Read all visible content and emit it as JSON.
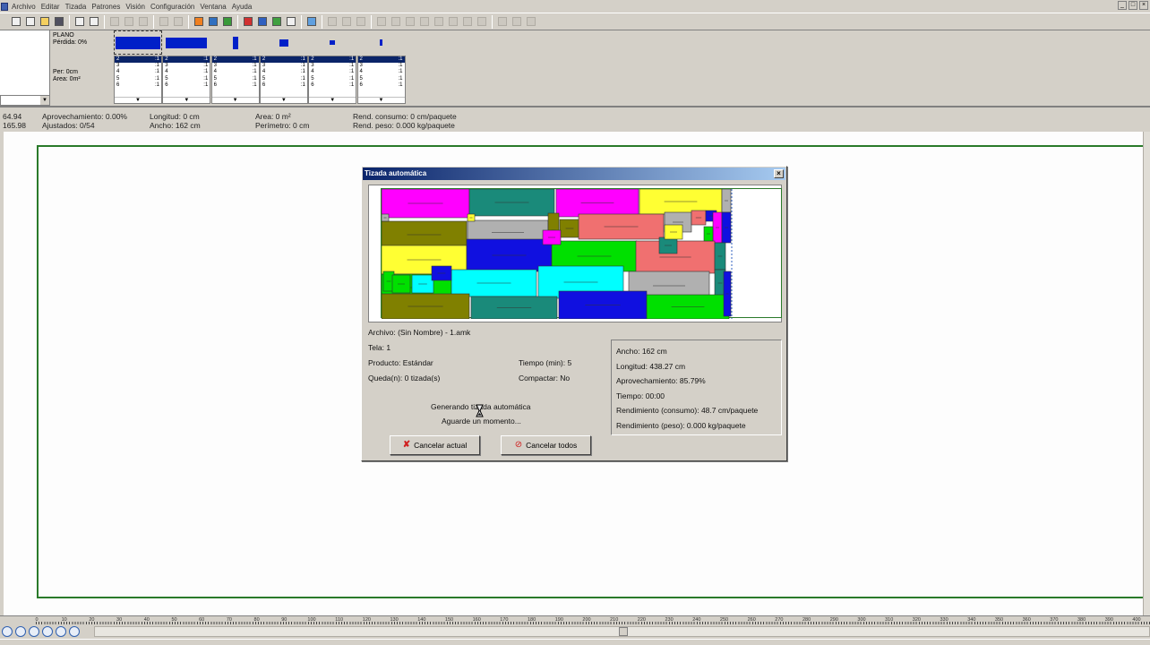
{
  "menu": {
    "items": [
      "Archivo",
      "Editar",
      "Tizada",
      "Patrones",
      "Visión",
      "Configuración",
      "Ventana",
      "Ayuda"
    ]
  },
  "toolbar": {
    "buttons": [
      "new-file-icon",
      "new-document-icon",
      "open-folder-icon",
      "save-icon",
      "edit-icon",
      "print-icon",
      "cut-icon",
      "copy-icon",
      "paste-icon",
      "undo-icon",
      "redo-icon",
      "auto-marker-icon",
      "save-marker-icon",
      "verify-icon",
      "delete-icon",
      "rotate-icon",
      "measure-icon",
      "window-icon",
      "eraser-icon"
    ]
  },
  "pattern_panel": {
    "plano_label": "PLANO",
    "perdida": "Pérdida: 0%",
    "per": "Per: 0cm",
    "area": "Area: 0m²",
    "columns": [
      {
        "sizes": [
          "2",
          "3",
          "4",
          "5",
          "6"
        ],
        "qty": [
          ":1",
          ":1",
          ":1",
          ":1",
          ":1"
        ]
      },
      {
        "sizes": [
          "2",
          "3",
          "4",
          "5",
          "6"
        ],
        "qty": [
          ":1",
          ":1",
          ":1",
          ":1",
          ":1"
        ]
      },
      {
        "sizes": [
          "2",
          "3",
          "4",
          "5",
          "6"
        ],
        "qty": [
          ":1",
          ":1",
          ":1",
          ":1",
          ":1"
        ]
      },
      {
        "sizes": [
          "2",
          "3",
          "4",
          "5",
          "6"
        ],
        "qty": [
          ":1",
          ":1",
          ":1",
          ":1",
          ":1"
        ]
      },
      {
        "sizes": [
          "2",
          "3",
          "4",
          "5",
          "6"
        ],
        "qty": [
          ":1",
          ":1",
          ":1",
          ":1",
          ":1"
        ]
      },
      {
        "sizes": [
          "2",
          "3",
          "4",
          "5",
          "6"
        ],
        "qty": [
          ":1",
          ":1",
          ":1",
          ":1",
          ":1"
        ]
      }
    ]
  },
  "status": {
    "coord_x": "64.94",
    "coord_y": "165.98",
    "aprovechamiento": "Aprovechamiento: 0.00%",
    "ajustados": "Ajustados: 0/54",
    "longitud": "Longitud: 0 cm",
    "ancho": "Ancho: 162 cm",
    "area": "Area: 0 m²",
    "perimetro": "Perímetro: 0 cm",
    "rend_consumo": "Rend. consumo: 0 cm/paquete",
    "rend_peso": "Rend. peso: 0.000 kg/paquete"
  },
  "ruler": {
    "labels": [
      "0",
      "10",
      "20",
      "30",
      "40",
      "50",
      "60",
      "70",
      "80",
      "90",
      "100",
      "110",
      "120",
      "130",
      "140",
      "150",
      "160",
      "170",
      "180",
      "190",
      "200",
      "210",
      "220",
      "230",
      "240",
      "250",
      "260",
      "270",
      "280",
      "290",
      "300",
      "310",
      "320",
      "330",
      "340",
      "350",
      "360",
      "370",
      "380",
      "390",
      "400"
    ]
  },
  "dialog": {
    "title": "Tizada automática",
    "close_label": "×",
    "archivo": "Archivo: (Sin Nombre) - 1.amk",
    "tela": "Tela: 1",
    "producto": "Producto: Estándar",
    "tiempo_min": "Tiempo (min): 5",
    "queda": "Queda(n): 0 tizada(s)",
    "compactar": "Compactar: No",
    "generando": "Generando tizada automática",
    "aguarde": "Aguarde un momento...",
    "results": {
      "ancho": "Ancho: 162 cm",
      "longitud": "Longitud: 438.27 cm",
      "aprovechamiento": "Aprovechamiento: 85.79%",
      "tiempo": "Tiempo: 00:00",
      "rend_consumo": "Rendimiento (consumo): 48.7 cm/paquete",
      "rend_peso": "Rendimiento (peso): 0.000 kg/paquete"
    },
    "cancel_current_label": "Cancelar actual",
    "cancel_all_label": "Cancelar todos"
  },
  "colors": {
    "marker_pieces": [
      "#ff00ff",
      "#1a8a7a",
      "#ff00ff",
      "#ffff33",
      "#808000",
      "#b0b0b0",
      "#f07070",
      "#00ffff",
      "#1010e0",
      "#00e000"
    ]
  }
}
